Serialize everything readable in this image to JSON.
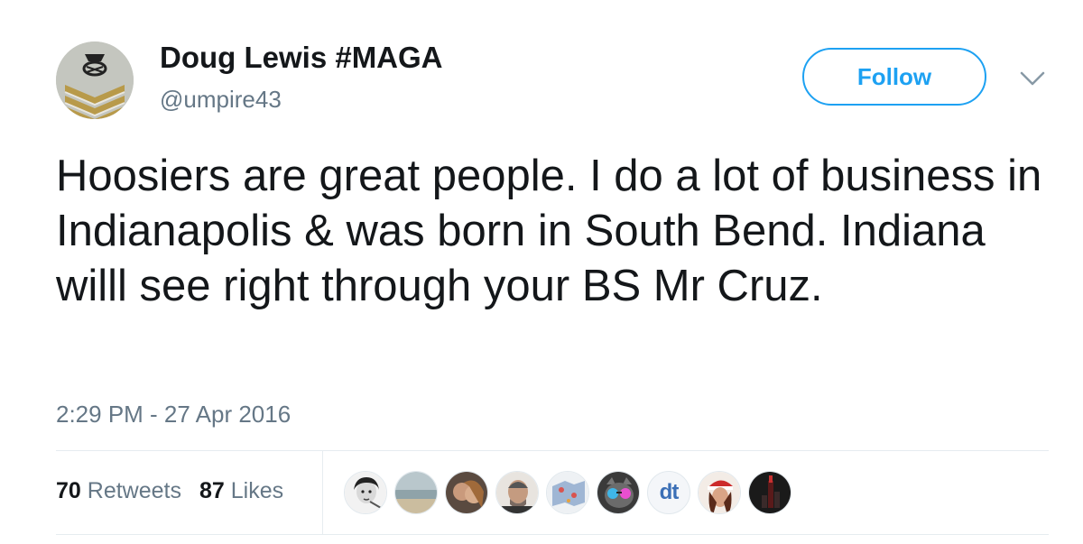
{
  "author": {
    "display_name": "Doug Lewis #MAGA",
    "handle": "@umpire43",
    "avatar_icon": "chevron-rank-insignia-icon"
  },
  "follow_button": {
    "label": "Follow"
  },
  "menu": {
    "icon": "chevron-down-icon"
  },
  "tweet": {
    "text": "Hoosiers are great people. I do a lot of business in Indianapolis & was born in South Bend. Indiana willl see right through your BS Mr Cruz.",
    "timestamp": "2:29 PM - 27 Apr 2016"
  },
  "stats": {
    "retweets_count": "70",
    "retweets_label": "Retweets",
    "likes_count": "87",
    "likes_label": "Likes"
  },
  "likers": [
    {
      "icon": "woman-portrait-avatar"
    },
    {
      "icon": "beach-avatar"
    },
    {
      "icon": "couple-photo-avatar"
    },
    {
      "icon": "man-portrait-avatar"
    },
    {
      "icon": "map-graphic-avatar"
    },
    {
      "icon": "cat-sunglasses-avatar"
    },
    {
      "label": "dt",
      "icon": "dt-logo-avatar"
    },
    {
      "icon": "santa-hat-woman-avatar"
    },
    {
      "icon": "city-night-avatar"
    }
  ],
  "colors": {
    "accent": "#1da1f2",
    "text": "#14171a",
    "muted": "#657786",
    "divider": "#e6ecf0",
    "dt_logo": "#3b6fb6"
  }
}
